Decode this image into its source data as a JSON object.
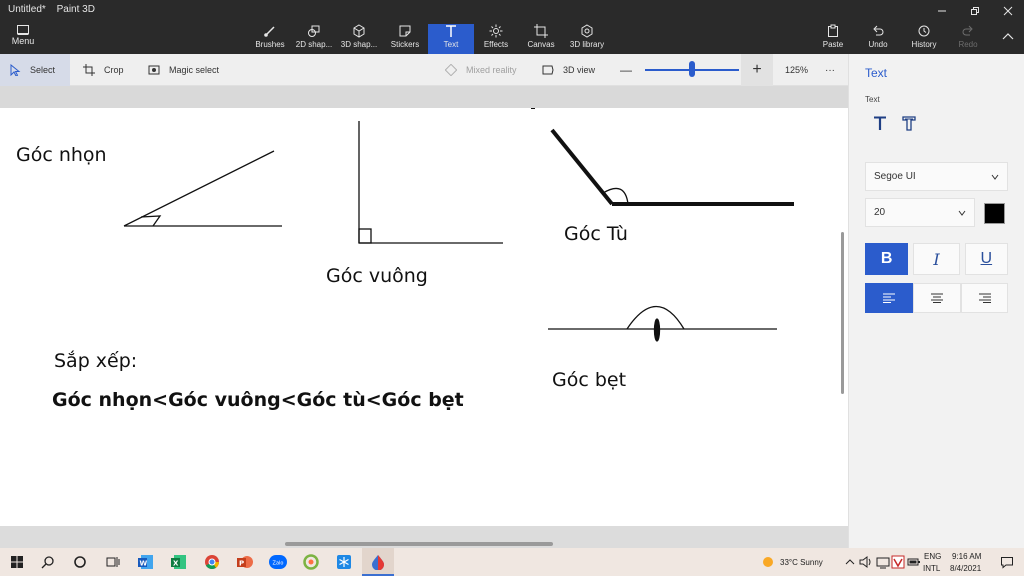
{
  "window": {
    "doc_title": "Untitled*",
    "app_name": "Paint 3D",
    "menu_label": "Menu"
  },
  "ribbon": {
    "tools": [
      {
        "label": "Brushes",
        "icon": "brush-icon"
      },
      {
        "label": "2D shap...",
        "icon": "2d-shapes-icon"
      },
      {
        "label": "3D shap...",
        "icon": "3d-shapes-icon"
      },
      {
        "label": "Stickers",
        "icon": "stickers-icon"
      },
      {
        "label": "Text",
        "icon": "text-icon",
        "active": true
      },
      {
        "label": "Effects",
        "icon": "effects-icon"
      },
      {
        "label": "Canvas",
        "icon": "canvas-icon"
      },
      {
        "label": "3D library",
        "icon": "3d-library-icon"
      }
    ],
    "actions": [
      {
        "label": "Paste",
        "icon": "paste-icon"
      },
      {
        "label": "Undo",
        "icon": "undo-icon"
      },
      {
        "label": "History",
        "icon": "history-icon"
      },
      {
        "label": "Redo",
        "icon": "redo-icon",
        "disabled": true
      }
    ]
  },
  "toolbar": {
    "select": "Select",
    "crop": "Crop",
    "magic_select": "Magic select",
    "mixed_reality": "Mixed reality",
    "view_3d": "3D view",
    "zoom_minus": "—",
    "zoom_plus": "+",
    "zoom_level": "125%",
    "zoom_fraction": 0.5,
    "more": "···"
  },
  "canvas": {
    "label_acute": "Góc nhọn",
    "label_right": "Góc vuông",
    "label_obtuse": "Góc Tù",
    "label_straight": "Góc bẹt",
    "sort_heading": "Sắp xếp:",
    "sort_result": "Góc nhọn<Góc vuông<Góc tù<Góc bẹt"
  },
  "panel": {
    "title": "Text",
    "subtitle": "Text",
    "font": "Segoe UI",
    "size": "20",
    "text_color": "#000000",
    "bold": "B",
    "italic": "I",
    "underline": "U"
  },
  "taskbar": {
    "weather": "33°C  Sunny",
    "lang_top": "ENG",
    "lang_bottom": "INTL",
    "time": "9:16 AM",
    "date": "8/4/2021",
    "zalo": "Zalo"
  },
  "colors": {
    "accent": "#2b5ccc",
    "ribbon_bg": "#2a2a2a",
    "taskbar_bg": "#f0e7e1"
  }
}
